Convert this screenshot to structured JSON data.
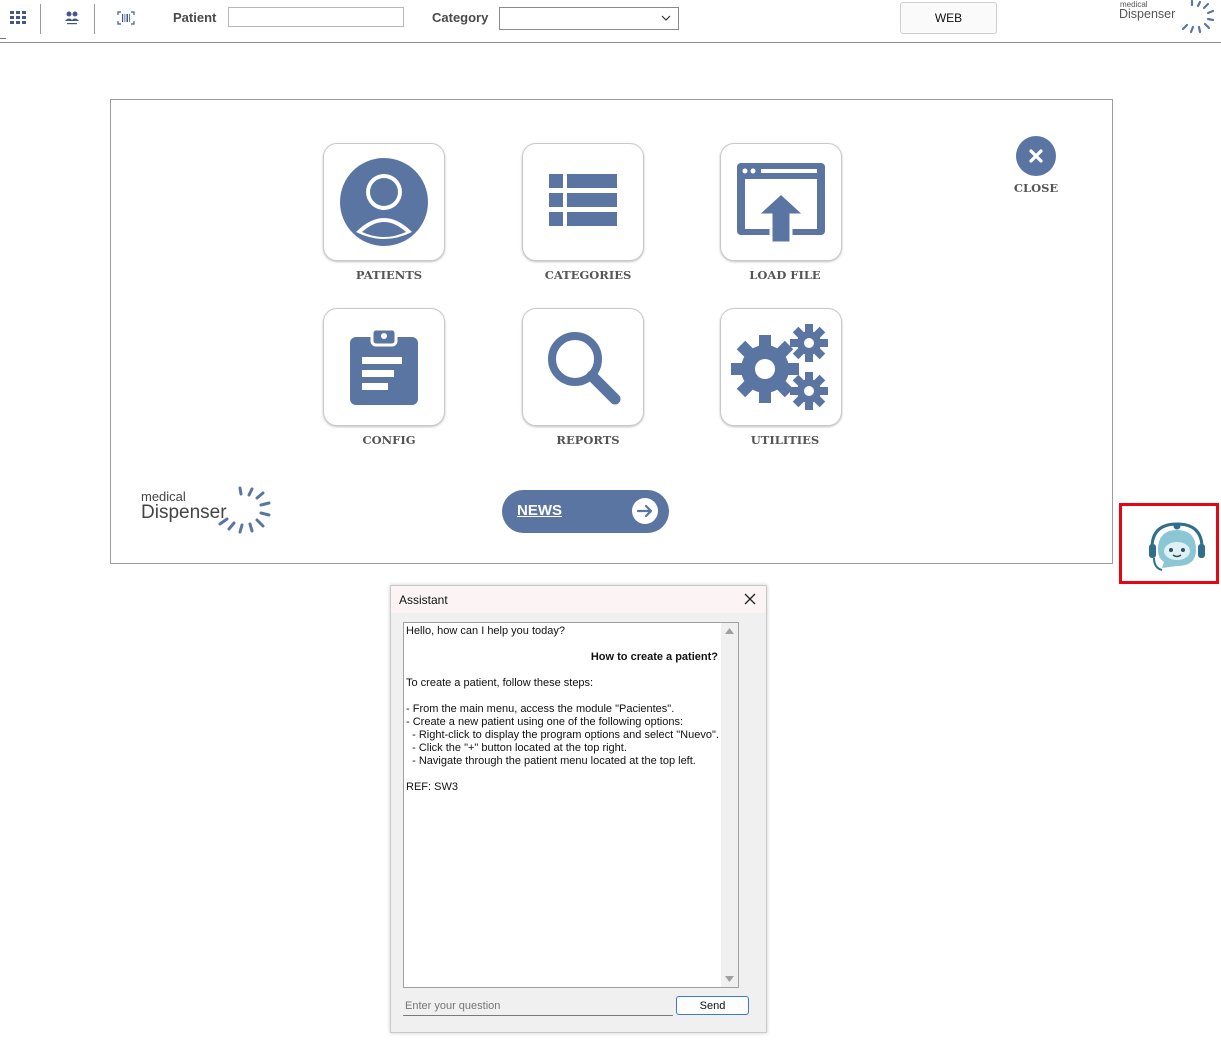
{
  "toolbar": {
    "apps_icon": "grid-icon",
    "users_icon": "users-switch-icon",
    "barcode_icon": "barcode-scan-icon",
    "patient_label": "Patient",
    "patient_value": "",
    "category_label": "Category",
    "category_value": "",
    "web_label": "WEB",
    "logo_small": "medical",
    "logo_big": "Dispenser"
  },
  "menu": {
    "tiles": [
      {
        "label": "PATIENTS",
        "icon": "user-icon"
      },
      {
        "label": "CATEGORIES",
        "icon": "list-icon"
      },
      {
        "label": "LOAD FILE",
        "icon": "upload-window-icon"
      },
      {
        "label": "CONFIG",
        "icon": "clipboard-icon"
      },
      {
        "label": "REPORTS",
        "icon": "search-icon"
      },
      {
        "label": "UTILITIES",
        "icon": "gears-icon"
      }
    ],
    "close_label": "CLOSE",
    "news_label": "NEWS",
    "logo_small": "medical",
    "logo_big": "Dispenser"
  },
  "colors": {
    "accent": "#5b75a3",
    "highlight_border": "#e30613",
    "bot": "#7fbfcf"
  },
  "assistant": {
    "title": "Assistant",
    "greeting": "Hello, how can I help you today?",
    "question": "How to create a patient?",
    "answer_lines": [
      "To create a patient, follow these steps:",
      "",
      "- From the main menu, access the module \"Pacientes\".",
      "- Create a new patient using one of the following options:",
      "  - Right-click to display the program options and select \"Nuevo\".",
      "  - Click the \"+\" button located at the top right.",
      "  - Navigate through the patient menu located at the top left.",
      "",
      "REF: SW3"
    ],
    "input_placeholder": "Enter your question",
    "send_label": "Send"
  }
}
